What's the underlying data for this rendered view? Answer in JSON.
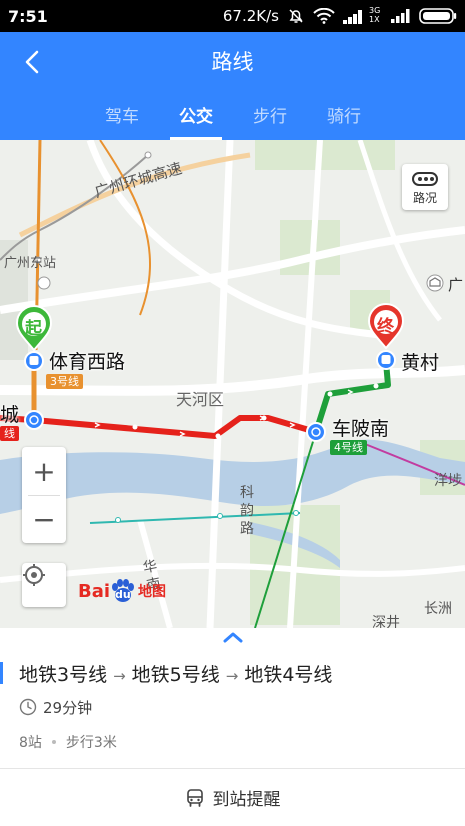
{
  "status_bar": {
    "time": "7:51",
    "network_speed": "67.2K/s",
    "sim_label_top": "3G",
    "sim_label_bottom": "1X"
  },
  "header": {
    "title": "路线",
    "tabs": [
      {
        "label": "驾车",
        "active": false
      },
      {
        "label": "公交",
        "active": true
      },
      {
        "label": "步行",
        "active": false
      },
      {
        "label": "骑行",
        "active": false
      }
    ]
  },
  "map": {
    "labels": {
      "ring_road": "广州环城高速",
      "east_station": "广州东站",
      "tianhe": "天河区",
      "kejun_road": "科韵路",
      "hua_road": "华南",
      "yangxi": "洋埗",
      "changzhou": "长洲",
      "shenjing": "深井",
      "guang": "广"
    },
    "start_marker": "起",
    "end_marker": "终",
    "stations": {
      "start": "体育西路",
      "end": "黄村",
      "transfer": "车陂南",
      "left_edge": "城"
    },
    "line_badges": {
      "line3": "3号线",
      "line4": "4号线",
      "left_edge_line": "线"
    },
    "traffic_button": "路况",
    "zoom_in": "+",
    "zoom_out": "−",
    "logo_bai": "Bai",
    "logo_du": "du",
    "logo_map": "地图",
    "colors": {
      "line3": "#e8912f",
      "line5": "#e5221b",
      "line4": "#1e9f3a",
      "primary": "#3385ff"
    }
  },
  "route": {
    "segments": [
      "地铁3号线",
      "地铁5号线",
      "地铁4号线"
    ],
    "arrow": "→",
    "duration": "29分钟",
    "stops": "8站",
    "walking": "步行3米",
    "reminder": "到站提醒"
  }
}
